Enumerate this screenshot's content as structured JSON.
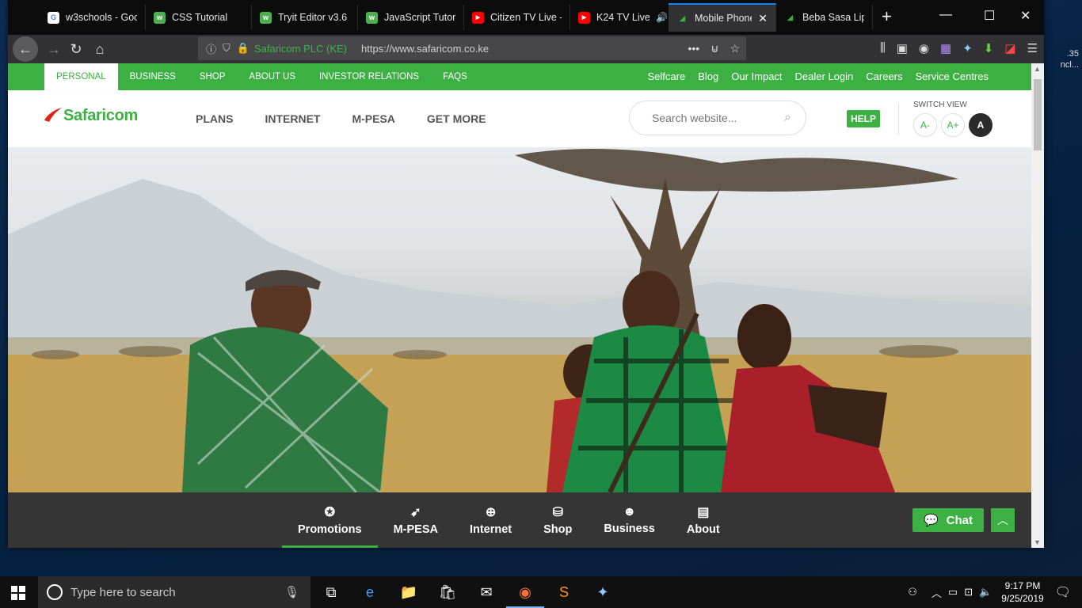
{
  "tabs": [
    {
      "label": "w3schools - Goo",
      "icon": "google-icon",
      "color": "#ffffff"
    },
    {
      "label": "CSS Tutorial",
      "icon": "w3schools-icon",
      "color": "#4caf50"
    },
    {
      "label": "Tryit Editor v3.6",
      "icon": "w3schools-icon",
      "color": "#4caf50"
    },
    {
      "label": "JavaScript Tutori",
      "icon": "w3schools-icon",
      "color": "#4caf50"
    },
    {
      "label": "Citizen TV Live -",
      "icon": "youtube-icon",
      "color": "#ff0000"
    },
    {
      "label": "K24 TV Live -",
      "icon": "youtube-icon",
      "color": "#ff0000"
    },
    {
      "label": "Mobile Phone",
      "icon": "safaricom-icon",
      "color": "#3cb043",
      "active": true
    },
    {
      "label": "Beba Sasa Lipa Po",
      "icon": "safaricom-icon",
      "color": "#3cb043"
    }
  ],
  "url": {
    "site_identity": "Safaricom PLC (KE)",
    "address": "https://www.safaricom.co.ke"
  },
  "site": {
    "brand": "Safaricom",
    "brand_color": "#3cb043",
    "top_left_links": [
      "PERSONAL",
      "BUSINESS",
      "SHOP",
      "ABOUT US",
      "INVESTOR RELATIONS",
      "FAQS"
    ],
    "top_right_links": [
      "Selfcare",
      "Blog",
      "Our Impact",
      "Dealer Login",
      "Careers",
      "Service Centres"
    ],
    "main_menu": [
      "PLANS",
      "INTERNET",
      "M-PESA",
      "GET MORE"
    ],
    "search_placeholder": "Search website...",
    "help_label": "HELP",
    "switch_view_label": "SWITCH VIEW",
    "switch_buttons": [
      "A-",
      "A+",
      "A"
    ]
  },
  "bottom_nav": [
    {
      "label": "Promotions",
      "icon": "star-badge-icon",
      "active": true
    },
    {
      "label": "M-PESA",
      "icon": "mpesa-icon"
    },
    {
      "label": "Internet",
      "icon": "globe-icon"
    },
    {
      "label": "Shop",
      "icon": "basket-icon"
    },
    {
      "label": "Business",
      "icon": "business-user-icon"
    },
    {
      "label": "About",
      "icon": "document-icon"
    }
  ],
  "chat_label": "Chat",
  "taskbar": {
    "search_placeholder": "Type here to search",
    "time": "9:17 PM",
    "date": "9/25/2019"
  },
  "desktop_edge_text": [
    ".35",
    "ncl..."
  ]
}
